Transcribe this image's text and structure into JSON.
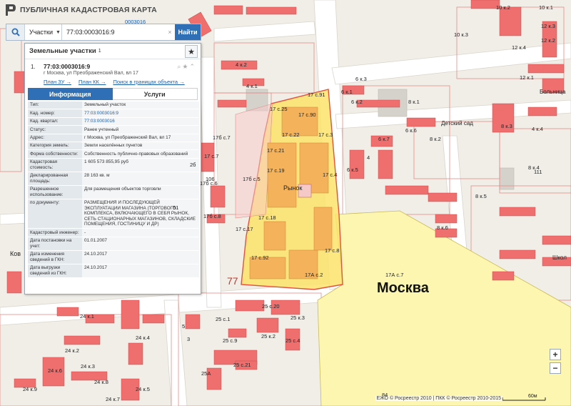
{
  "header": {
    "title": "ПУБЛИЧНАЯ КАДАСТРОВАЯ КАРТА",
    "quarter_label": "0003016"
  },
  "search": {
    "category": "Участки",
    "value": "77:03:0003016:9",
    "clear": "×",
    "button": "Найти"
  },
  "panel": {
    "title": "Земельные участки",
    "count": "1",
    "star": "★",
    "result": {
      "num": "1.",
      "id": "77:03:0003016:9",
      "address": "г Москва, ул Преображенский Вал, вл 17",
      "links": [
        "План ЗУ →",
        "План КК →",
        "Поиск в границах объекта →"
      ]
    },
    "tabs": [
      "Информация",
      "Услуги"
    ],
    "info": [
      {
        "k": "Тип:",
        "v": "Земельный участок"
      },
      {
        "k": "Кад. номер:",
        "v": "77:03:0003016:9",
        "link": true
      },
      {
        "k": "Кад. квартал:",
        "v": "77:03:0003016",
        "link": true
      },
      {
        "k": "Статус:",
        "v": "Ранее учтенный"
      },
      {
        "k": "Адрес:",
        "v": "г Москва, ул Преображенский Вал, вл 17"
      },
      {
        "k": "Категория земель:",
        "v": "Земли населённых пунктов"
      },
      {
        "k": "Форма собственности:",
        "v": "Собственность публично-правовых образований"
      },
      {
        "k": "Кадастровая стоимость:",
        "v": "1 605 573 855,95 руб"
      },
      {
        "k": "Декларированная площадь:",
        "v": "28 163 кв. м"
      },
      {
        "k": "Разрешенное использование:",
        "v": "Для размещения объектов торговли"
      },
      {
        "k": "по документу:",
        "v": "РАЗМЕЩЕНИЯ И ПОСЛЕДУЮЩЕЙ ЭКСПЛУАТАЦИИ МАГАЗИНА (ТОРГОВОГО КОМПЛЕКСА, ВКЛЮЧАЮЩЕГО В СЕБЯ РЫНОК, СЕТЬ СТАЦИОНАРНЫХ МАГАЗИНОВ, СКЛАДСКИЕ ПОМЕЩЕНИЯ, ГОСТИНИЦУ И ДР)"
      },
      {
        "k": "Кадастровый инженер:",
        "v": "-"
      },
      {
        "k": "Дата постановки на учет:",
        "v": "01.01.2007"
      },
      {
        "k": "Дата изменения сведений в ГКН:",
        "v": "24.10.2017"
      },
      {
        "k": "Дата выгрузки сведений из ГКН:",
        "v": "24.10.2017"
      }
    ]
  },
  "map": {
    "city_label": "Москва",
    "market_label": "Рынок",
    "kindergarten": "Детский сад",
    "hospital": "Больница",
    "school": "Школ",
    "street_fragment": "Ков",
    "region_code": "77",
    "bld_number": "84",
    "house_labels": [
      {
        "t": "10 к.2"
      },
      {
        "t": "10 к.1"
      },
      {
        "t": "12 к.3"
      },
      {
        "t": "12 к.4"
      },
      {
        "t": "12 к.2"
      },
      {
        "t": "10 к.3"
      },
      {
        "t": "12 к.1"
      },
      {
        "t": "4 к.2"
      },
      {
        "t": "6 к.3"
      },
      {
        "t": "4 к.1"
      },
      {
        "t": "6 к.2"
      },
      {
        "t": "4"
      },
      {
        "t": "17 с.91"
      },
      {
        "t": "6 к.1"
      },
      {
        "t": "8 к.1"
      },
      {
        "t": "17 с.25"
      },
      {
        "t": "17 с.90"
      },
      {
        "t": "17 с.22"
      },
      {
        "t": "17 с.3"
      },
      {
        "t": "17 с.21"
      },
      {
        "t": "17 с.19"
      },
      {
        "t": "17 с.4"
      },
      {
        "t": "17 с.7"
      },
      {
        "t": "17б с.7"
      },
      {
        "t": "17б с.6"
      },
      {
        "t": "17б с.8"
      },
      {
        "t": "17б с.5"
      },
      {
        "t": "17 с.18"
      },
      {
        "t": "17 с.17"
      },
      {
        "t": "17 с.92"
      },
      {
        "t": "17 с.8"
      },
      {
        "t": "17А с.2"
      },
      {
        "t": "17А с.7"
      },
      {
        "t": "6 к.7"
      },
      {
        "t": "6 к.6"
      },
      {
        "t": "6 к.5"
      },
      {
        "t": "8 к.3"
      },
      {
        "t": "8 к.2"
      },
      {
        "t": "8 к.4"
      },
      {
        "t": "8 к.5"
      },
      {
        "t": "8 к.6"
      },
      {
        "t": "25 с.20"
      },
      {
        "t": "25 к.3"
      },
      {
        "t": "25 с.1"
      },
      {
        "t": "25 с.9"
      },
      {
        "t": "25 к.2"
      },
      {
        "t": "25 с.21"
      },
      {
        "t": "25А"
      },
      {
        "t": "25 с.4"
      },
      {
        "t": "24 к.1"
      },
      {
        "t": "24 к.2"
      },
      {
        "t": "24 к.3"
      },
      {
        "t": "24 к.4"
      },
      {
        "t": "24 к.5"
      },
      {
        "t": "24 к.6"
      },
      {
        "t": "24 к.9"
      },
      {
        "t": "24 к.7"
      },
      {
        "t": "24 к.8"
      },
      {
        "t": "3"
      },
      {
        "t": "5"
      },
      {
        "t": "4 к.4"
      },
      {
        "t": "111"
      },
      {
        "t": "51"
      },
      {
        "t": "106"
      },
      {
        "t": "2б"
      }
    ]
  },
  "zoom": {
    "in": "+",
    "out": "−"
  },
  "footer": {
    "copyright": "ЕЖО © Росреестр 2010 | ПКК © Росреестр 2010-2015",
    "scale": "60м"
  }
}
